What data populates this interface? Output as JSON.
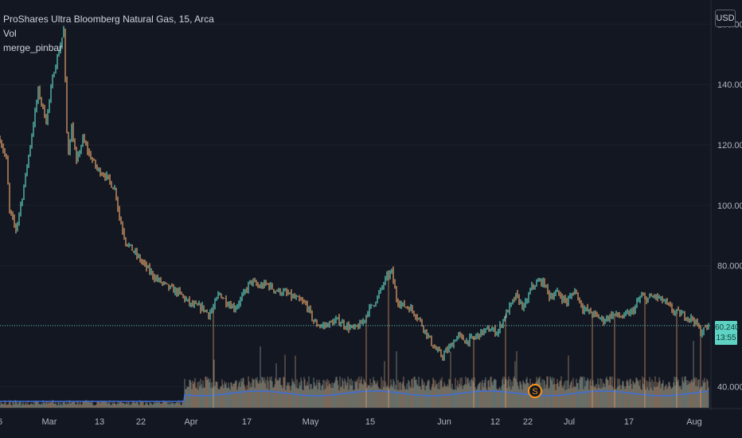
{
  "legend": {
    "symbol_line": "ProShares Ultra Bloomberg Natural Gas, 15, Arca",
    "indicator_vol": "Vol",
    "indicator_pinbar": "merge_pinbar"
  },
  "currency_button": "USD",
  "last_price": {
    "value": "60.240",
    "countdown": "13:55",
    "color": "#5fd3c3"
  },
  "event_marker": {
    "label": "S",
    "color": "#f7931a"
  },
  "colors": {
    "background": "#131722",
    "up": "#5fd3c3",
    "down": "#e8a56c",
    "volume_ma": "#3f6fd8",
    "price_line": "#4fb6ad"
  },
  "chart_data": {
    "type": "line",
    "title": "ProShares Ultra Bloomberg Natural Gas, 15, Arca",
    "ylim": [
      33,
      168
    ],
    "y_ticks": [
      40,
      60,
      80,
      100,
      120,
      140,
      160
    ],
    "y_tick_labels": [
      "40.000",
      "",
      "80.000",
      "100.000",
      "120.000",
      "140.000",
      "160.000"
    ],
    "x_tick_labels": [
      "6",
      "Mar",
      "13",
      "22",
      "Apr",
      "17",
      "May",
      "15",
      "Jun",
      "12",
      "22",
      "Jul",
      "17",
      "Aug"
    ],
    "x_tick_index": [
      0,
      62,
      125,
      177,
      240,
      310,
      390,
      465,
      558,
      622,
      663,
      715,
      790,
      872
    ],
    "series": [
      {
        "name": "",
        "x_index": [
          0,
          8,
          12,
          20,
          28,
          38,
          48,
          58,
          68,
          75,
          80,
          84,
          86,
          90,
          96,
          104,
          112,
          122,
          132,
          145,
          150,
          158,
          170,
          182,
          195,
          210,
          225,
          240,
          255,
          262,
          268,
          275,
          285,
          295,
          305,
          315,
          325,
          335,
          345,
          358,
          372,
          385,
          395,
          405,
          415,
          425,
          435,
          445,
          455,
          462,
          468,
          475,
          485,
          492,
          498,
          505,
          515,
          525,
          535,
          545,
          555,
          565,
          575,
          585,
          595,
          605,
          615,
          625,
          635,
          642,
          648,
          658,
          668,
          678,
          684,
          690,
          700,
          712,
          722,
          732,
          745,
          758,
          770,
          782,
          795,
          805,
          812,
          822,
          835,
          845,
          855,
          865,
          872,
          880,
          890
        ],
        "values": [
          122,
          115,
          98,
          92,
          103,
          120,
          138,
          128,
          145,
          152,
          158,
          124,
          118,
          126,
          114,
          122,
          117,
          112,
          110,
          105,
          96,
          88,
          84,
          80,
          76,
          73,
          71,
          67,
          66,
          64,
          66,
          71,
          68,
          66,
          70,
          75,
          73,
          74,
          72,
          71,
          69,
          67,
          61,
          60,
          61,
          62,
          60,
          59,
          61,
          65,
          67,
          70,
          76,
          78,
          69,
          67,
          66,
          63,
          58,
          53,
          50,
          53,
          57,
          55,
          56,
          58,
          59,
          58,
          64,
          67,
          70,
          66,
          73,
          75,
          74,
          70,
          71,
          68,
          72,
          66,
          64,
          62,
          64,
          63,
          65,
          70,
          69,
          70,
          68,
          65,
          64,
          63,
          62,
          58,
          60
        ]
      }
    ]
  }
}
